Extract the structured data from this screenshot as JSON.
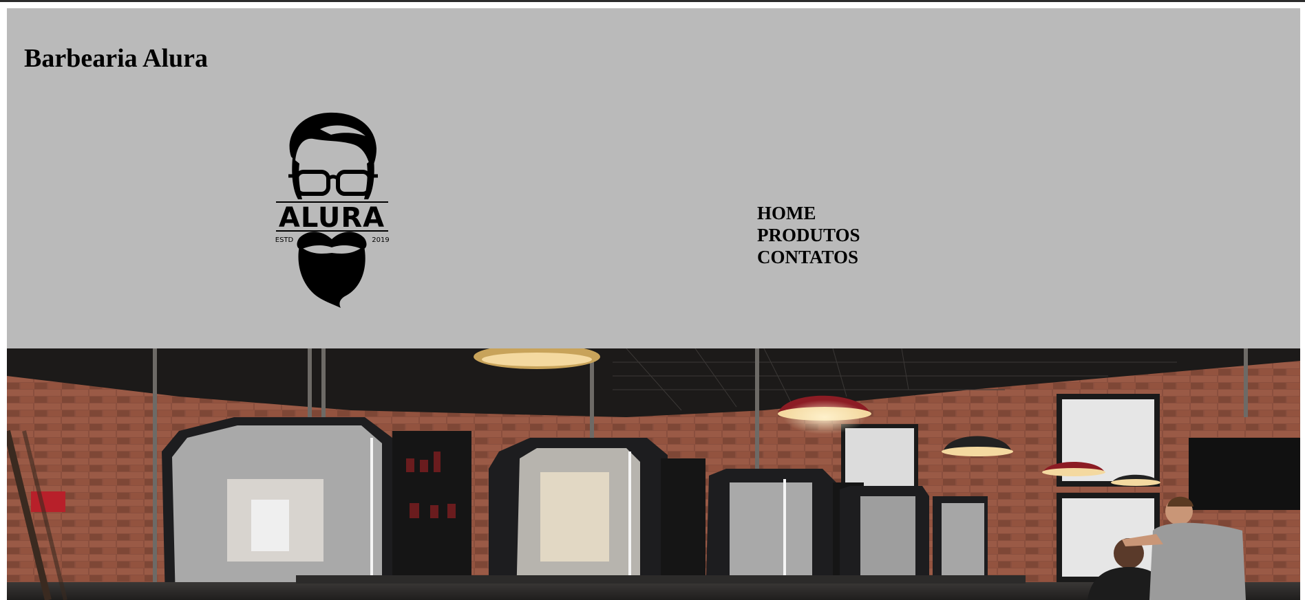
{
  "header": {
    "title": "Barbearia Alura",
    "background": "#bababa"
  },
  "logo": {
    "name": "ALURA",
    "est_label": "ESTD",
    "year": "2019",
    "icon": "bearded-man-with-glasses-logo"
  },
  "nav": {
    "items": [
      {
        "label": "HOME"
      },
      {
        "label": "PRODUTOS"
      },
      {
        "label": "CONTATOS"
      }
    ]
  },
  "hero": {
    "description_icon": "barbershop-interior-photo",
    "colors": {
      "brick": "#8a4f3e",
      "ceiling": "#1c1a19",
      "lamp_red": "#8c1c24",
      "mirror_frame": "#1d1d1f",
      "light": "#f4d9a0"
    }
  }
}
